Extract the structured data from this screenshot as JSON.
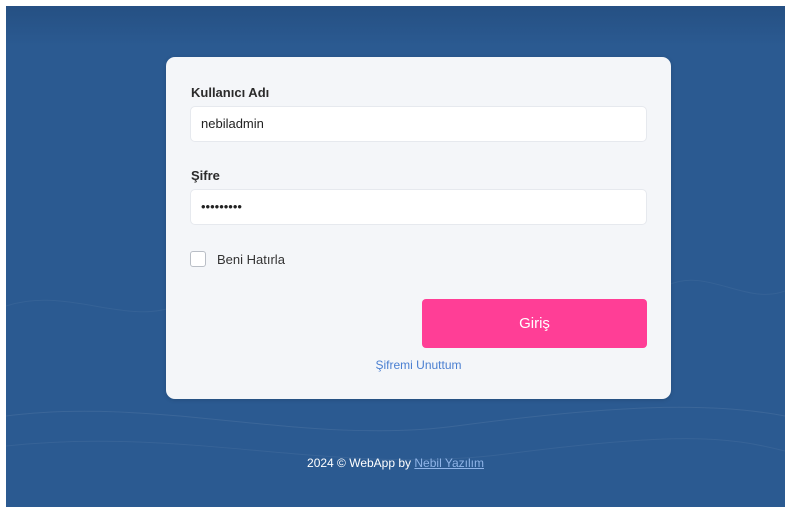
{
  "form": {
    "username_label": "Kullanıcı Adı",
    "username_value": "nebiladmin",
    "password_label": "Şifre",
    "password_value": "•••••••••",
    "remember_label": "Beni Hatırla",
    "remember_checked": false,
    "submit_label": "Giriş",
    "forgot_label": "Şifremi Unuttum"
  },
  "footer": {
    "text": "2024 © WebApp by",
    "link_label": "Nebil Yazılım"
  },
  "colors": {
    "background": "#2b5a91",
    "card": "#f4f6f9",
    "primary_button": "#ff3e96",
    "link": "#4a7fd1"
  }
}
